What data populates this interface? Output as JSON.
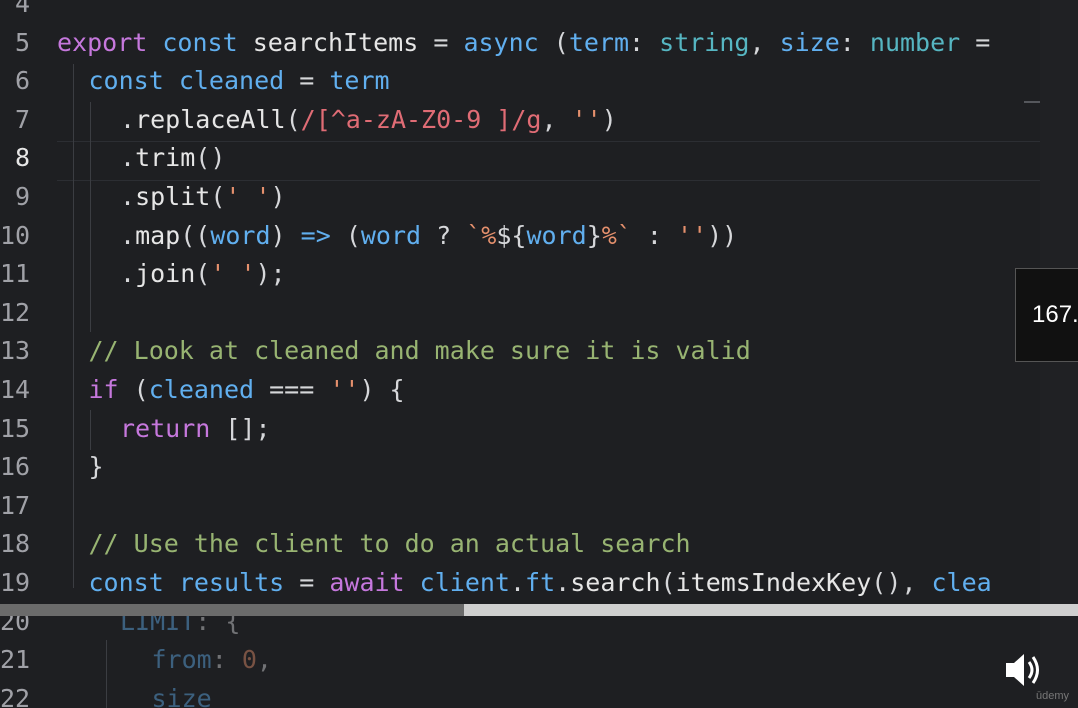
{
  "player": {
    "time_display": "167.",
    "progress_fraction": 0.43,
    "brand": "ūdemy"
  },
  "editor": {
    "line_numbers": [
      "4",
      "5",
      "6",
      "7",
      "8",
      "9",
      "10",
      "11",
      "12",
      "13",
      "14",
      "15",
      "16",
      "17",
      "18",
      "19",
      "20",
      "21",
      "22"
    ],
    "lines": [
      {
        "tokens": []
      },
      {
        "tokens": [
          [
            "k",
            "export"
          ],
          [
            "p",
            " "
          ],
          [
            "c",
            "const"
          ],
          [
            "p",
            " "
          ],
          [
            "f",
            "searchItems"
          ],
          [
            "op",
            " = "
          ],
          [
            "c",
            "async"
          ],
          [
            "p",
            " ("
          ],
          [
            "v",
            "term"
          ],
          [
            "p",
            ": "
          ],
          [
            "t",
            "string"
          ],
          [
            "p",
            ", "
          ],
          [
            "v",
            "size"
          ],
          [
            "p",
            ": "
          ],
          [
            "t",
            "number"
          ],
          [
            "op",
            " ="
          ]
        ]
      },
      {
        "tokens": [
          [
            "c",
            "const"
          ],
          [
            "p",
            " "
          ],
          [
            "v",
            "cleaned"
          ],
          [
            "op",
            " = "
          ],
          [
            "v",
            "term"
          ]
        ]
      },
      {
        "tokens": [
          [
            "p",
            "."
          ],
          [
            "f",
            "replaceAll"
          ],
          [
            "p",
            "("
          ],
          [
            "r",
            "/[^a-zA-Z0-9 ]/g"
          ],
          [
            "p",
            ", "
          ],
          [
            "s",
            "''"
          ],
          [
            "p",
            ")"
          ]
        ]
      },
      {
        "tokens": [
          [
            "p",
            "."
          ],
          [
            "f",
            "trim"
          ],
          [
            "p",
            "()"
          ]
        ]
      },
      {
        "tokens": [
          [
            "p",
            "."
          ],
          [
            "f",
            "split"
          ],
          [
            "p",
            "("
          ],
          [
            "s",
            "' '"
          ],
          [
            "p",
            ")"
          ]
        ]
      },
      {
        "tokens": [
          [
            "p",
            "."
          ],
          [
            "f",
            "map"
          ],
          [
            "p",
            "(("
          ],
          [
            "v",
            "word"
          ],
          [
            "p",
            ") "
          ],
          [
            "c",
            "=>"
          ],
          [
            "p",
            " ("
          ],
          [
            "v",
            "word"
          ],
          [
            "op",
            " ? "
          ],
          [
            "s",
            "`%"
          ],
          [
            "p",
            "${"
          ],
          [
            "v",
            "word"
          ],
          [
            "p",
            "}"
          ],
          [
            "s",
            "%`"
          ],
          [
            "op",
            " : "
          ],
          [
            "s",
            "''"
          ],
          [
            "p",
            "))"
          ]
        ]
      },
      {
        "tokens": [
          [
            "p",
            "."
          ],
          [
            "f",
            "join"
          ],
          [
            "p",
            "("
          ],
          [
            "s",
            "' '"
          ],
          [
            "p",
            ");"
          ]
        ]
      },
      {
        "tokens": []
      },
      {
        "tokens": [
          [
            "cm",
            "// Look at cleaned and make sure it is valid"
          ]
        ]
      },
      {
        "tokens": [
          [
            "k",
            "if"
          ],
          [
            "p",
            " ("
          ],
          [
            "v",
            "cleaned"
          ],
          [
            "op",
            " === "
          ],
          [
            "s",
            "''"
          ],
          [
            "p",
            ") {"
          ]
        ]
      },
      {
        "tokens": [
          [
            "k",
            "return"
          ],
          [
            "p",
            " [];"
          ]
        ]
      },
      {
        "tokens": [
          [
            "p",
            "}"
          ]
        ]
      },
      {
        "tokens": []
      },
      {
        "tokens": [
          [
            "cm",
            "// Use the client to do an actual search"
          ]
        ]
      },
      {
        "tokens": [
          [
            "c",
            "const"
          ],
          [
            "p",
            " "
          ],
          [
            "v",
            "results"
          ],
          [
            "op",
            " = "
          ],
          [
            "k",
            "await"
          ],
          [
            "p",
            " "
          ],
          [
            "v",
            "client"
          ],
          [
            "p",
            "."
          ],
          [
            "v",
            "ft"
          ],
          [
            "p",
            "."
          ],
          [
            "f",
            "search"
          ],
          [
            "p",
            "("
          ],
          [
            "f",
            "itemsIndexKey"
          ],
          [
            "p",
            "(), "
          ],
          [
            "v",
            "clea"
          ]
        ]
      },
      {
        "tokens": [
          [
            "v",
            "LIMIT"
          ],
          [
            "p",
            ": {"
          ]
        ]
      },
      {
        "tokens": [
          [
            "v",
            "from"
          ],
          [
            "p",
            ": "
          ],
          [
            "s",
            "0"
          ],
          [
            "p",
            ","
          ]
        ]
      },
      {
        "tokens": [
          [
            "v",
            "size"
          ]
        ]
      }
    ]
  }
}
